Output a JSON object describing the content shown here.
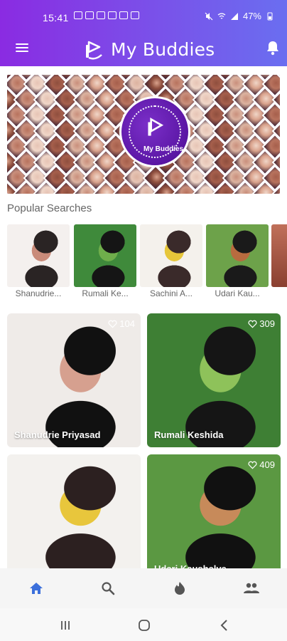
{
  "status": {
    "time": "15:41",
    "battery": "47%"
  },
  "app": {
    "title": "My Buddies",
    "banner_logo_text": "My Buddies"
  },
  "popular": {
    "title": "Popular Searches",
    "items": [
      {
        "name": "Shanudrie...",
        "palette": [
          "#f4f0ee",
          "#c98b7a",
          "#2a2424"
        ]
      },
      {
        "name": "Rumali Ke...",
        "palette": [
          "#3f8a3b",
          "#6fae4b",
          "#151515"
        ]
      },
      {
        "name": "Sachini A...",
        "palette": [
          "#f4f1ec",
          "#e6c63a",
          "#3a2a2a"
        ]
      },
      {
        "name": "Udari Kau...",
        "palette": [
          "#6da24a",
          "#b86b3f",
          "#1a1a1a"
        ]
      }
    ]
  },
  "cards": [
    {
      "name": "Shanudrie Priyasad",
      "likes": "104",
      "palette": [
        "#efebe8",
        "#d6a08f",
        "#111111"
      ]
    },
    {
      "name": "Rumali Keshida",
      "likes": "309",
      "palette": [
        "#3e7f34",
        "#8ec25a",
        "#151515"
      ]
    },
    {
      "name": "",
      "likes": "",
      "palette": [
        "#f3f1ee",
        "#e8c63c",
        "#2c2020"
      ]
    },
    {
      "name": "Udari Kaushalya",
      "likes": "409",
      "palette": [
        "#5b9842",
        "#c78a5a",
        "#111111"
      ]
    }
  ],
  "colors": {
    "header_start": "#8a2be2",
    "header_end": "#6a6ef0",
    "nav_active": "#3b6fdb",
    "nav_inactive": "#555555"
  },
  "icons": [
    "menu-icon",
    "bell-icon",
    "home-icon",
    "search-icon",
    "fire-icon",
    "people-icon",
    "heart-icon"
  ]
}
